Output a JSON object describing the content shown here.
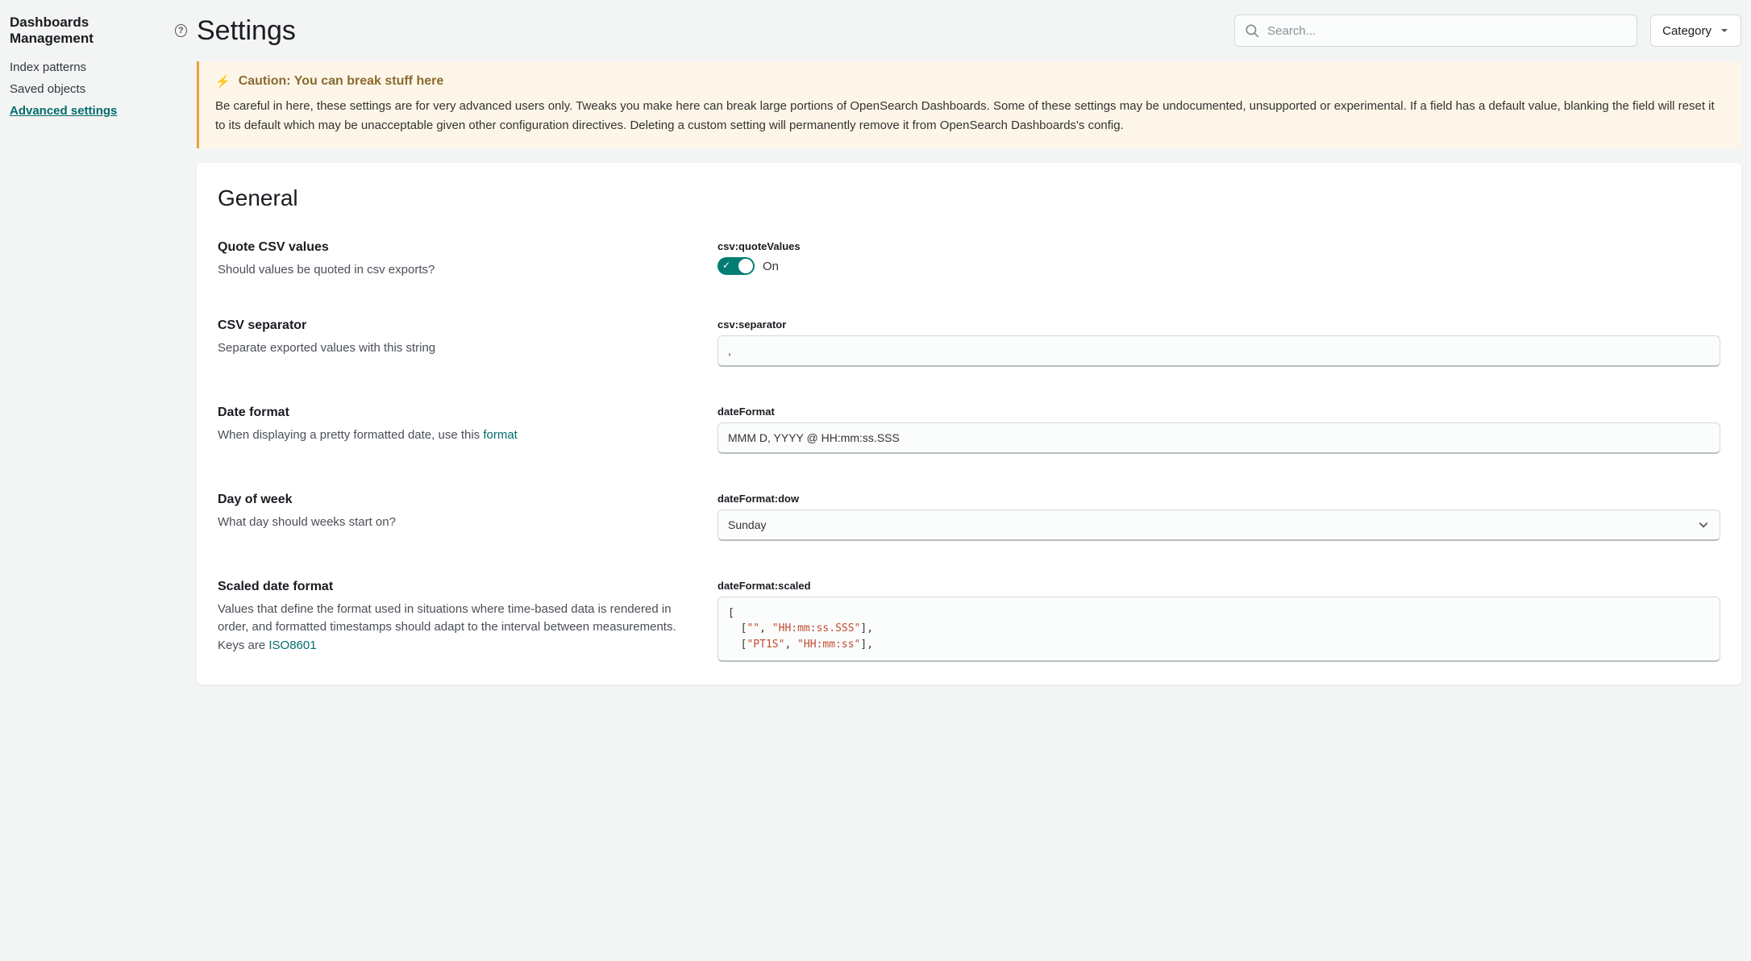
{
  "sidebar": {
    "title": "Dashboards Management",
    "items": [
      {
        "label": "Index patterns",
        "active": false
      },
      {
        "label": "Saved objects",
        "active": false
      },
      {
        "label": "Advanced settings",
        "active": true
      }
    ]
  },
  "header": {
    "title": "Settings",
    "search_placeholder": "Search...",
    "category_label": "Category"
  },
  "callout": {
    "title": "Caution: You can break stuff here",
    "body": "Be careful in here, these settings are for very advanced users only. Tweaks you make here can break large portions of OpenSearch Dashboards. Some of these settings may be undocumented, unsupported or experimental. If a field has a default value, blanking the field will reset it to its default which may be unacceptable given other configuration directives. Deleting a custom setting will permanently remove it from OpenSearch Dashboards's config."
  },
  "section": {
    "title": "General"
  },
  "settings": {
    "quote_csv": {
      "title": "Quote CSV values",
      "desc": "Should values be quoted in csv exports?",
      "key": "csv:quoteValues",
      "state_label": "On"
    },
    "csv_separator": {
      "title": "CSV separator",
      "desc": "Separate exported values with this string",
      "key": "csv:separator",
      "value": ","
    },
    "date_format": {
      "title": "Date format",
      "desc_prefix": "When displaying a pretty formatted date, use this ",
      "desc_link": "format",
      "key": "dateFormat",
      "value": "MMM D, YYYY @ HH:mm:ss.SSS"
    },
    "dow": {
      "title": "Day of week",
      "desc": "What day should weeks start on?",
      "key": "dateFormat:dow",
      "value": "Sunday"
    },
    "scaled": {
      "title": "Scaled date format",
      "desc_prefix": "Values that define the format used in situations where time-based data is rendered in order, and formatted timestamps should adapt to the interval between measurements. Keys are ",
      "desc_link": "ISO8601",
      "key": "dateFormat:scaled",
      "code_lines": [
        "[",
        "  [\"\", \"HH:mm:ss.SSS\"],",
        "  [\"PT1S\", \"HH:mm:ss\"],"
      ]
    }
  }
}
